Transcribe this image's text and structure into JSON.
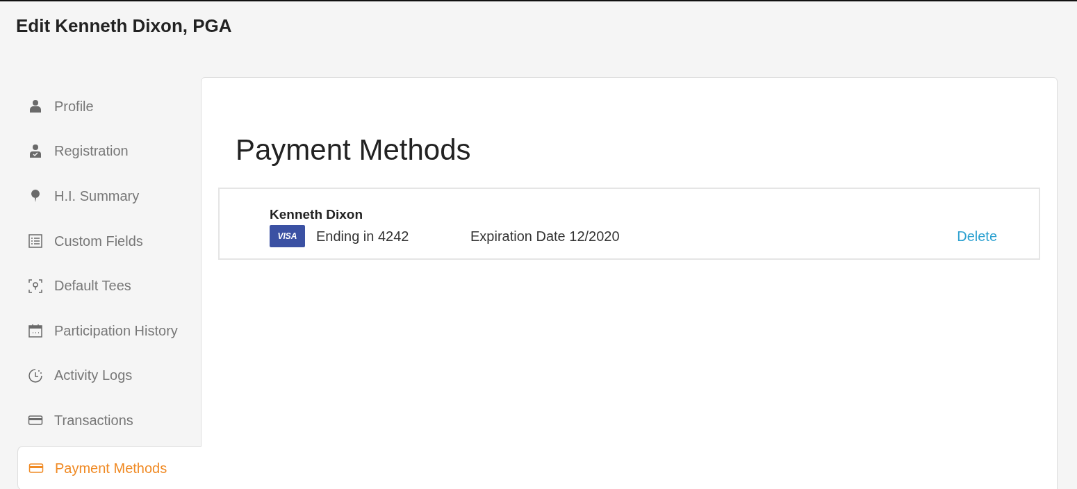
{
  "page_title": "Edit Kenneth Dixon, PGA",
  "sidebar": {
    "items": [
      {
        "label": "Profile",
        "selected": false
      },
      {
        "label": "Registration",
        "selected": false
      },
      {
        "label": "H.I. Summary",
        "selected": false
      },
      {
        "label": "Custom Fields",
        "selected": false
      },
      {
        "label": "Default Tees",
        "selected": false
      },
      {
        "label": "Participation History",
        "selected": false
      },
      {
        "label": "Activity Logs",
        "selected": false
      },
      {
        "label": "Transactions",
        "selected": false
      },
      {
        "label": "Payment Methods",
        "selected": true
      }
    ]
  },
  "panel": {
    "heading": "Payment Methods",
    "cards": [
      {
        "holder": "Kenneth Dixon",
        "brand": "VISA",
        "ending": "Ending in 4242",
        "expiration": "Expiration Date 12/2020",
        "action": "Delete"
      }
    ]
  }
}
